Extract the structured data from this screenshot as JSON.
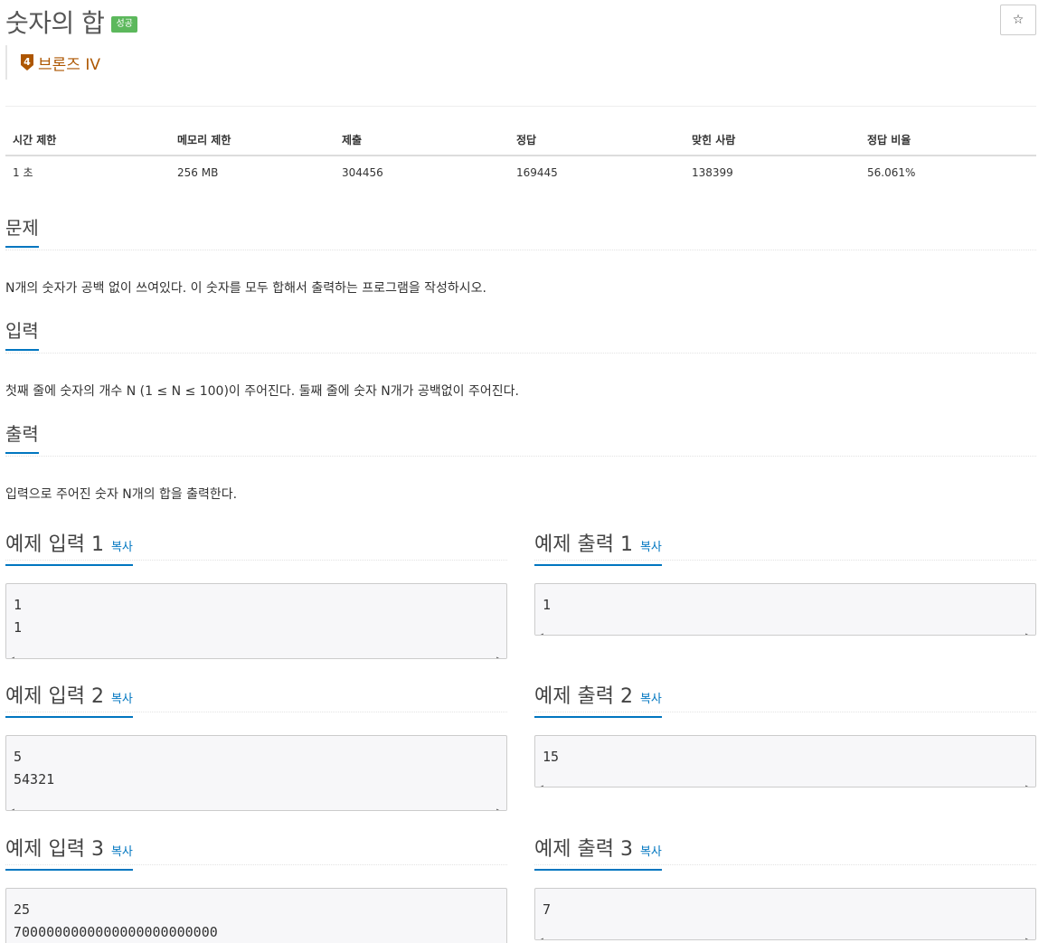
{
  "problem": {
    "title": "숫자의 합",
    "status_badge": "성공",
    "star_icon": "☆",
    "tier_number": "4",
    "tier_label": "브론즈 IV",
    "tier_color": "#ad5600"
  },
  "info_table": {
    "headers": [
      "시간 제한",
      "메모리 제한",
      "제출",
      "정답",
      "맞힌 사람",
      "정답 비율"
    ],
    "values": [
      "1 초",
      "256 MB",
      "304456",
      "169445",
      "138399",
      "56.061%"
    ]
  },
  "sections": {
    "description": {
      "title": "문제",
      "text": "N개의 숫자가 공백 없이 쓰여있다. 이 숫자를 모두 합해서 출력하는 프로그램을 작성하시오."
    },
    "input": {
      "title": "입력",
      "text": "첫째 줄에 숫자의 개수 N (1 ≤ N ≤ 100)이 주어진다. 둘째 줄에 숫자 N개가 공백없이 주어진다."
    },
    "output": {
      "title": "출력",
      "text": "입력으로 주어진 숫자 N개의 합을 출력한다."
    }
  },
  "copy_label": "복사",
  "examples": [
    {
      "input_title": "예제 입력 1",
      "input_lines": [
        "1",
        "1"
      ],
      "output_title": "예제 출력 1",
      "output_lines": [
        "1"
      ]
    },
    {
      "input_title": "예제 입력 2",
      "input_lines": [
        "5",
        "54321"
      ],
      "output_title": "예제 출력 2",
      "output_lines": [
        "15"
      ]
    },
    {
      "input_title": "예제 입력 3",
      "input_lines": [
        "25",
        "7000000000000000000000000"
      ],
      "output_title": "예제 출력 3",
      "output_lines": [
        "7"
      ]
    }
  ],
  "colors": {
    "accent": "#0076c0",
    "success": "#5cb85c",
    "bronze": "#ad5600"
  }
}
